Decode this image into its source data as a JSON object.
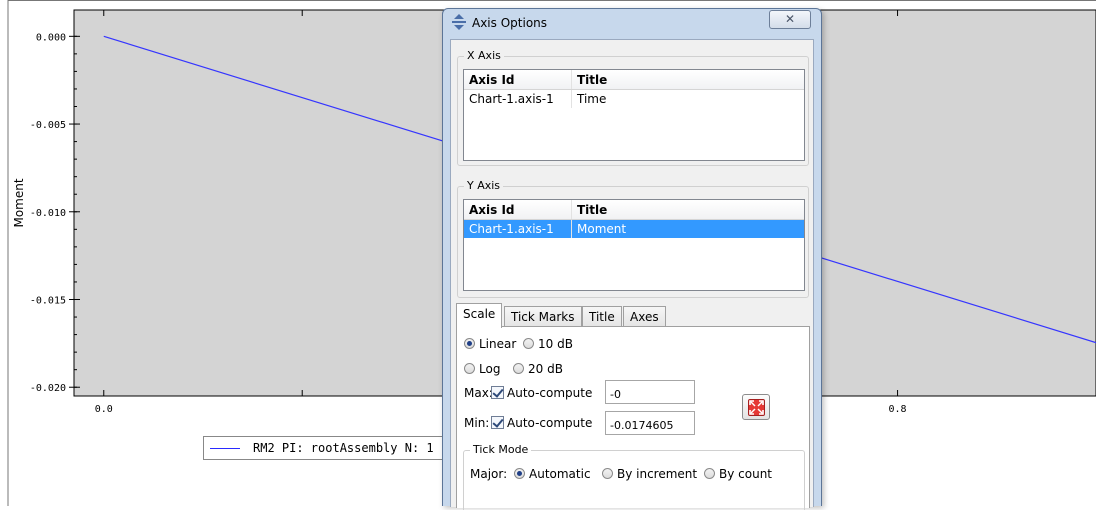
{
  "chart_data": {
    "type": "line",
    "title": "",
    "xlabel": "",
    "ylabel": "Moment",
    "x_ticks": [
      "0.0",
      "0.8"
    ],
    "y_ticks": [
      "0.000",
      "-0.005",
      "-0.010",
      "-0.015",
      "-0.020"
    ],
    "xlim": [
      -0.03,
      1.0
    ],
    "ylim": [
      -0.0205,
      0.0015
    ],
    "grid": false,
    "background": "#d4d4d4",
    "series": [
      {
        "name": "RM2 PI: rootAssembly N: 1",
        "color": "#3535ff",
        "x": [
          0.0,
          1.0
        ],
        "y": [
          0.0,
          -0.0174605
        ]
      }
    ]
  },
  "legend": {
    "text": "RM2 PI: rootAssembly N: 1"
  },
  "dialog": {
    "title": "Axis Options",
    "close_symbol": "✕",
    "x_axis": {
      "group_label": "X Axis",
      "columns": [
        "Axis Id",
        "Title"
      ],
      "rows": [
        {
          "axis_id": "Chart-1.axis-1",
          "title": "Time"
        }
      ]
    },
    "y_axis": {
      "group_label": "Y Axis",
      "columns": [
        "Axis Id",
        "Title"
      ],
      "rows": [
        {
          "axis_id": "Chart-1.axis-1",
          "title": "Moment",
          "selected": true
        }
      ]
    },
    "tabs": [
      "Scale",
      "Tick Marks",
      "Title",
      "Axes"
    ],
    "active_tab": "Scale",
    "scale": {
      "linear_label": "Linear",
      "db10_label": "10 dB",
      "log_label": "Log",
      "db20_label": "20 dB",
      "selected_scale": "Linear",
      "max_label": "Max:",
      "min_label": "Min:",
      "auto_compute_label": "Auto-compute",
      "max_auto": true,
      "min_auto": true,
      "max_value": "-0",
      "min_value": "-0.0174605"
    },
    "tick_mode": {
      "group_label": "Tick Mode",
      "major_label": "Major:",
      "options": [
        "Automatic",
        "By increment",
        "By count"
      ],
      "selected": "Automatic"
    }
  }
}
